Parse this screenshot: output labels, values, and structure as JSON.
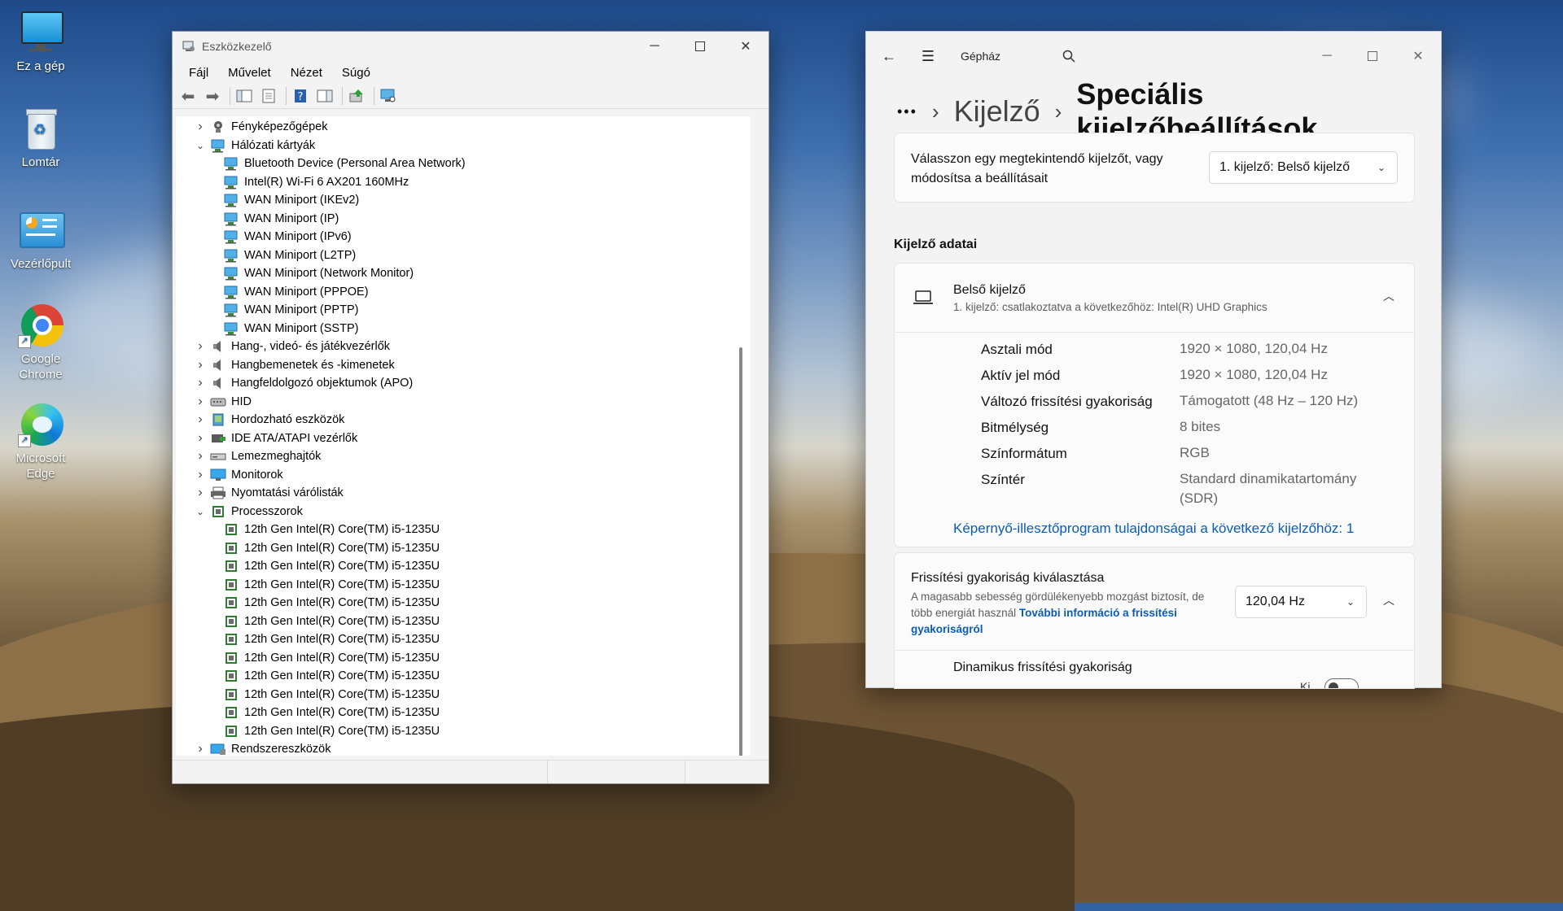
{
  "desktop": {
    "icons": [
      {
        "label": "Ez a gép",
        "icon": "this-pc-icon"
      },
      {
        "label": "Lomtár",
        "icon": "recycle-bin-icon"
      },
      {
        "label": "Vezérlőpult",
        "icon": "control-panel-icon"
      },
      {
        "label": "Google Chrome",
        "icon": "chrome-icon"
      },
      {
        "label": "Microsoft Edge",
        "icon": "edge-icon"
      }
    ]
  },
  "device_manager": {
    "title": "Eszközkezelő",
    "menu": [
      "Fájl",
      "Művelet",
      "Nézet",
      "Súgó"
    ],
    "tree": [
      {
        "label": "Fényképezőgépek",
        "level": 0,
        "state": "collapsed",
        "icon": "camera-icon"
      },
      {
        "label": "Hálózati kártyák",
        "level": 0,
        "state": "expanded",
        "icon": "network-adapter-icon"
      },
      {
        "label": "Bluetooth Device (Personal Area Network)",
        "level": 1,
        "icon": "network-adapter-icon"
      },
      {
        "label": "Intel(R) Wi-Fi 6 AX201 160MHz",
        "level": 1,
        "icon": "network-adapter-icon"
      },
      {
        "label": "WAN Miniport (IKEv2)",
        "level": 1,
        "icon": "network-adapter-icon"
      },
      {
        "label": "WAN Miniport (IP)",
        "level": 1,
        "icon": "network-adapter-icon"
      },
      {
        "label": "WAN Miniport (IPv6)",
        "level": 1,
        "icon": "network-adapter-icon"
      },
      {
        "label": "WAN Miniport (L2TP)",
        "level": 1,
        "icon": "network-adapter-icon"
      },
      {
        "label": "WAN Miniport (Network Monitor)",
        "level": 1,
        "icon": "network-adapter-icon"
      },
      {
        "label": "WAN Miniport (PPPOE)",
        "level": 1,
        "icon": "network-adapter-icon"
      },
      {
        "label": "WAN Miniport (PPTP)",
        "level": 1,
        "icon": "network-adapter-icon"
      },
      {
        "label": "WAN Miniport (SSTP)",
        "level": 1,
        "icon": "network-adapter-icon"
      },
      {
        "label": "Hang-, videó- és játékvezérlők",
        "level": 0,
        "state": "collapsed",
        "icon": "speaker-icon"
      },
      {
        "label": "Hangbemenetek és -kimenetek",
        "level": 0,
        "state": "collapsed",
        "icon": "speaker-icon"
      },
      {
        "label": "Hangfeldolgozó objektumok (APO)",
        "level": 0,
        "state": "collapsed",
        "icon": "speaker-icon"
      },
      {
        "label": "HID",
        "level": 0,
        "state": "collapsed",
        "icon": "hid-icon"
      },
      {
        "label": "Hordozható eszközök",
        "level": 0,
        "state": "collapsed",
        "icon": "portable-device-icon"
      },
      {
        "label": "IDE ATA/ATAPI vezérlők",
        "level": 0,
        "state": "collapsed",
        "icon": "ide-controller-icon"
      },
      {
        "label": "Lemezmeghajtók",
        "level": 0,
        "state": "collapsed",
        "icon": "disk-drive-icon"
      },
      {
        "label": "Monitorok",
        "level": 0,
        "state": "collapsed",
        "icon": "monitor-icon"
      },
      {
        "label": "Nyomtatási várólisták",
        "level": 0,
        "state": "collapsed",
        "icon": "printer-icon"
      },
      {
        "label": "Processzorok",
        "level": 0,
        "state": "expanded",
        "icon": "processor-icon"
      },
      {
        "label": "12th Gen Intel(R) Core(TM) i5-1235U",
        "level": 1,
        "icon": "processor-icon"
      },
      {
        "label": "12th Gen Intel(R) Core(TM) i5-1235U",
        "level": 1,
        "icon": "processor-icon"
      },
      {
        "label": "12th Gen Intel(R) Core(TM) i5-1235U",
        "level": 1,
        "icon": "processor-icon"
      },
      {
        "label": "12th Gen Intel(R) Core(TM) i5-1235U",
        "level": 1,
        "icon": "processor-icon"
      },
      {
        "label": "12th Gen Intel(R) Core(TM) i5-1235U",
        "level": 1,
        "icon": "processor-icon"
      },
      {
        "label": "12th Gen Intel(R) Core(TM) i5-1235U",
        "level": 1,
        "icon": "processor-icon"
      },
      {
        "label": "12th Gen Intel(R) Core(TM) i5-1235U",
        "level": 1,
        "icon": "processor-icon"
      },
      {
        "label": "12th Gen Intel(R) Core(TM) i5-1235U",
        "level": 1,
        "icon": "processor-icon"
      },
      {
        "label": "12th Gen Intel(R) Core(TM) i5-1235U",
        "level": 1,
        "icon": "processor-icon"
      },
      {
        "label": "12th Gen Intel(R) Core(TM) i5-1235U",
        "level": 1,
        "icon": "processor-icon"
      },
      {
        "label": "12th Gen Intel(R) Core(TM) i5-1235U",
        "level": 1,
        "icon": "processor-icon"
      },
      {
        "label": "12th Gen Intel(R) Core(TM) i5-1235U",
        "level": 1,
        "icon": "processor-icon"
      },
      {
        "label": "Rendszereszközök",
        "level": 0,
        "state": "collapsed",
        "icon": "system-devices-icon"
      }
    ]
  },
  "settings": {
    "app_title": "Gépház",
    "breadcrumb": {
      "ellipsis": "•••",
      "parent": "Kijelző",
      "current": "Speciális kijelzőbeállítások"
    },
    "select_display": {
      "label": "Válasszon egy megtekintendő kijelzőt, vagy módosítsa a beállításait",
      "value": "1. kijelző: Belső kijelző"
    },
    "section_title": "Kijelző adatai",
    "display": {
      "name": "Belső kijelző",
      "subtitle": "1. kijelző: csatlakoztatva a következőhöz: Intel(R) UHD Graphics",
      "props": [
        {
          "key": "Asztali mód",
          "value": "1920 × 1080, 120,04 Hz"
        },
        {
          "key": "Aktív jel mód",
          "value": "1920 × 1080, 120,04 Hz"
        },
        {
          "key": "Változó frissítési gyakoriság",
          "value": "Támogatott (48 Hz – 120 Hz)"
        },
        {
          "key": "Bitmélység",
          "value": "8 bites"
        },
        {
          "key": "Színformátum",
          "value": "RGB"
        },
        {
          "key": "Színtér",
          "value": "Standard dinamikatartomány (SDR)"
        }
      ],
      "adapter_link": "Képernyő-illesztőprogram tulajdonságai a következő kijelzőhöz: 1"
    },
    "refresh": {
      "title": "Frissítési gyakoriság kiválasztása",
      "desc": "A magasabb sebesség gördülékenyebb mozgást biztosít, de több energiát használ",
      "link": "További információ a frissítési gyakoriságról",
      "value": "120,04 Hz"
    },
    "dynamic": {
      "title": "Dinamikus frissítési gyakoriság",
      "toggle_label": "Ki"
    }
  }
}
